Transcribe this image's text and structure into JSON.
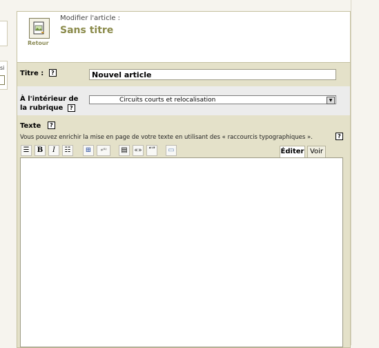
{
  "left_fragment": {
    "text": "si"
  },
  "header": {
    "retour_label": "Retour",
    "modifier_label": "Modifier l'article :",
    "article_title": "Sans titre"
  },
  "form": {
    "titre_label": "Titre :",
    "titre_value": "Nouvel article",
    "rubrique_label": "À l'intérieur de la rubrique",
    "rubrique_value": "Circuits courts et relocalisation",
    "texte_label": "Texte",
    "help_glyph": "?",
    "hint": "Vous pouvez enrichir la mise en page de votre texte en utilisant des « raccourcis typographiques ».",
    "editor_content": ""
  },
  "toolbar": {
    "buttons": [
      {
        "name": "heading-icon",
        "glyph": "☰"
      },
      {
        "name": "bold-icon",
        "glyph": "B"
      },
      {
        "name": "italic-icon",
        "glyph": "I"
      },
      {
        "name": "list-icon",
        "glyph": "☷"
      },
      {
        "name": "link-icon",
        "glyph": "⊞"
      },
      {
        "name": "footnote-icon",
        "glyph": "»⁽¹⁾"
      },
      {
        "name": "block-icon",
        "glyph": "▤"
      },
      {
        "name": "guillemets-icon",
        "glyph": "«»"
      },
      {
        "name": "quotes-icon",
        "glyph": "“”"
      },
      {
        "name": "preview-icon",
        "glyph": "▭"
      }
    ]
  },
  "tabs": {
    "edit_label": "Éditer",
    "voir_label": "Voir"
  }
}
